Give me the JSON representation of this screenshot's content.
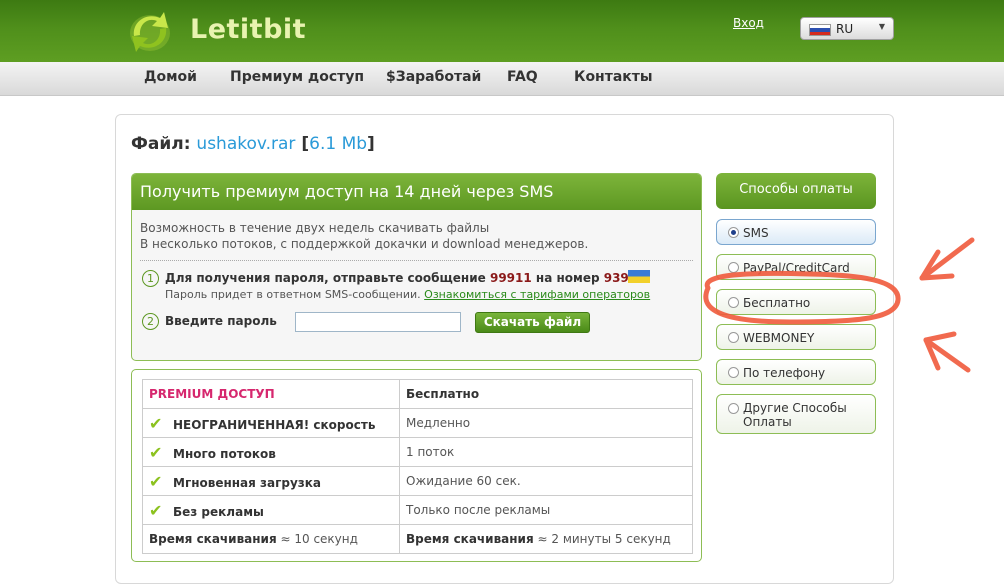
{
  "header": {
    "logo_text": "Letitbit",
    "login_link": "Вход",
    "language": "RU"
  },
  "nav": {
    "items": [
      "Домой",
      "Премиум доступ",
      "$Заработай",
      "FAQ",
      "Контакты"
    ]
  },
  "file": {
    "label": "Файл:",
    "name": "ushakov.rar",
    "size": "6.1 Mb"
  },
  "sms": {
    "title": "Получить премиум доступ на 14 дней через SMS",
    "desc_line1": "Возможность в течение двух недель скачивать файлы",
    "desc_line2": "В несколько потоков, с поддержкой докачки и download менеджеров.",
    "step1_number": "1",
    "step1_prefix": "Для получения пароля, отправьте сообщение",
    "step1_code": "99911",
    "step1_middle": "на номер",
    "step1_phone": "9395",
    "step1_sub": "Пароль придет в ответном SMS-сообщении.",
    "step1_link": "Ознакомиться с тарифами операторов",
    "step2_number": "2",
    "step2_label": "Введите пароль",
    "password_value": "",
    "download_button": "Скачать файл"
  },
  "compare": {
    "header_premium": "PREMIUM доступ",
    "header_free": "Бесплатно",
    "rows": [
      {
        "feature": "НЕОГРАНИЧЕННАЯ! скорость",
        "free": "Медленно"
      },
      {
        "feature": "Много потоков",
        "free": "1 поток"
      },
      {
        "feature": "Мгновенная загрузка",
        "free": "Ожидание 60 сек."
      },
      {
        "feature": "Без рекламы",
        "free": "Только после рекламы"
      }
    ],
    "time_label": "Время скачивания",
    "time_premium": "≈ 10 секунд",
    "time_free": "≈ 2 минуты 5 секунд"
  },
  "payment": {
    "title": "Способы оплаты",
    "options": [
      "SMS",
      "PayPal/CreditCard",
      "Бесплатно",
      "WEBMONEY",
      "По телефону",
      "Другие Способы",
      "Оплаты"
    ],
    "selected": "SMS"
  },
  "colors": {
    "brand_green": "#5d9822",
    "premium_pink": "#d6276e",
    "link_blue": "#2a9ad8",
    "annotation_red": "#f05a3c"
  }
}
